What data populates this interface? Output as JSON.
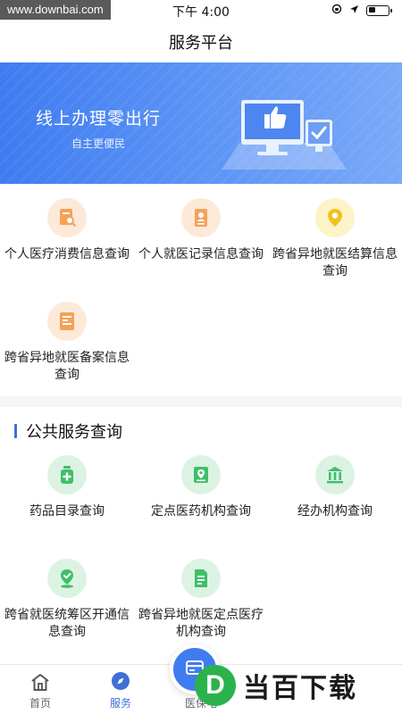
{
  "status_bar": {
    "watermark_url": "www.downbai.com",
    "time": "下午 4:00",
    "icons": [
      "orientation-lock-icon",
      "location-arrow-icon",
      "battery-icon"
    ]
  },
  "nav": {
    "title": "服务平台"
  },
  "banner": {
    "title": "线上办理零出行",
    "subtitle": "自主更便民"
  },
  "quick_services": [
    {
      "label": "个人医疗消费信息查询",
      "icon": "search-document-icon",
      "color": "#f5a15a"
    },
    {
      "label": "个人就医记录信息查询",
      "icon": "person-card-icon",
      "color": "#f5a15a"
    },
    {
      "label": "跨省异地就医结算信息查询",
      "icon": "location-pin-icon",
      "color": "#f2c11f"
    },
    {
      "label": "跨省异地就医备案信息查询",
      "icon": "id-card-icon",
      "color": "#f5a15a"
    }
  ],
  "public_services": {
    "title": "公共服务查询",
    "items": [
      {
        "label": "药品目录查询",
        "icon": "medicine-bottle-icon",
        "color": "#3fbf6a"
      },
      {
        "label": "定点医药机构查询",
        "icon": "map-location-icon",
        "color": "#3fbf6a"
      },
      {
        "label": "经办机构查询",
        "icon": "bank-building-icon",
        "color": "#3fbf6a"
      },
      {
        "label": "跨省就医统筹区开通信息查询",
        "icon": "location-shield-icon",
        "color": "#3fbf6a"
      },
      {
        "label": "跨省异地就医定点医疗机构查询",
        "icon": "hospital-document-icon",
        "color": "#3fbf6a"
      }
    ]
  },
  "tab_bar": {
    "tabs": [
      {
        "label": "首页",
        "icon": "home-icon",
        "active": false
      },
      {
        "label": "服务",
        "icon": "compass-icon",
        "active": true
      },
      {
        "label": "医保电",
        "icon": "medical-insurance-card-icon",
        "active": false
      }
    ]
  },
  "watermark_logo": {
    "mark": "D",
    "text": "当百下载"
  },
  "colors": {
    "accent": "#3f6fd8",
    "banner": "#4a86f3",
    "orange": "#f5a15a",
    "green": "#3fbf6a"
  }
}
